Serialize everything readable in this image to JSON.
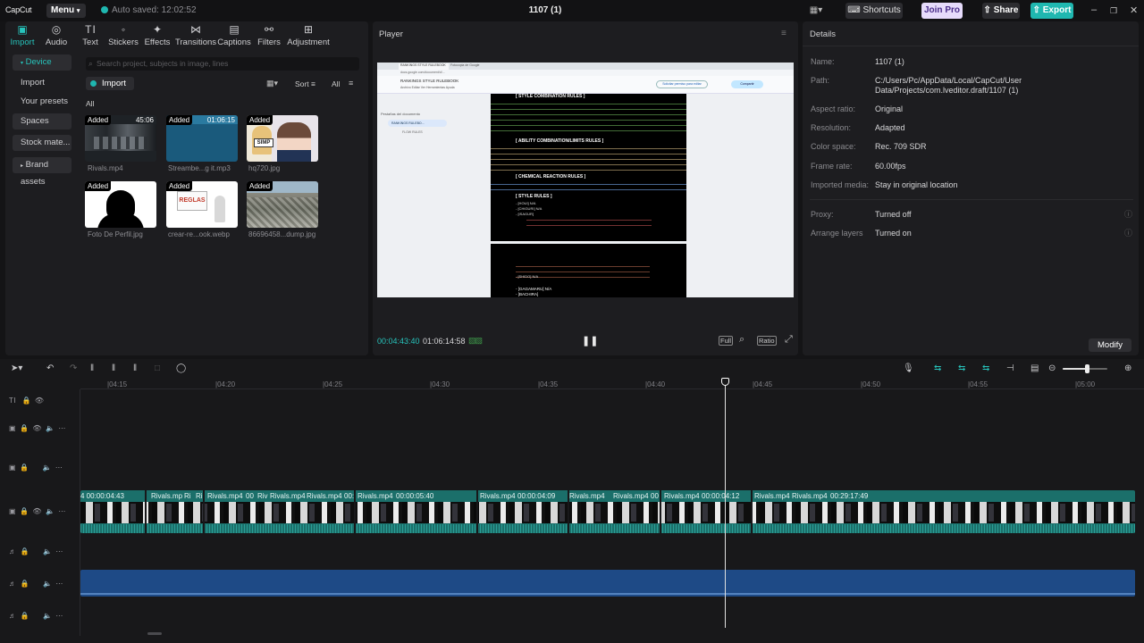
{
  "app": {
    "logo": "CapCut",
    "menu_label": "Menu",
    "autosave": "Auto saved: 12:02:52",
    "project_title": "1107 (1)",
    "shortcuts_label": "Shortcuts",
    "joinpro_label": "Join Pro",
    "share_label": "Share",
    "export_label": "Export",
    "accent_color": "#1fb7b0"
  },
  "toolbar_tabs": [
    {
      "label": "Import",
      "icon": "import-icon"
    },
    {
      "label": "Audio",
      "icon": "audio-icon"
    },
    {
      "label": "Text",
      "icon": "text-icon"
    },
    {
      "label": "Stickers",
      "icon": "stickers-icon"
    },
    {
      "label": "Effects",
      "icon": "effects-icon"
    },
    {
      "label": "Transitions",
      "icon": "transitions-icon"
    },
    {
      "label": "Captions",
      "icon": "captions-icon"
    },
    {
      "label": "Filters",
      "icon": "filters-icon"
    },
    {
      "label": "Adjustment",
      "icon": "adjustment-icon"
    }
  ],
  "media_sidebar": [
    "Device",
    "Import",
    "Your presets",
    "Spaces",
    "Stock mate...",
    "Brand assets"
  ],
  "media": {
    "search_placeholder": "Search project, subjects in image, lines",
    "import_label": "Import",
    "sort_label": "Sort",
    "all_filter": "All",
    "all_heading": "All",
    "items": [
      {
        "name": "Rivals.mp4",
        "badge": "Added",
        "duration": "45:06"
      },
      {
        "name": "Streambe...g it.mp3",
        "badge": "Added",
        "duration": "01:06:15"
      },
      {
        "name": "hq720.jpg",
        "badge": "Added",
        "duration": ""
      },
      {
        "name": "Foto De Perfil.jpg",
        "badge": "Added",
        "duration": ""
      },
      {
        "name": "crear-re...ook.webp",
        "badge": "Added",
        "duration": ""
      },
      {
        "name": "86696458...dump.jpg",
        "badge": "Added",
        "duration": ""
      }
    ],
    "thumb_texts": {
      "simp": "SIMP",
      "reglas": "REGLAS"
    }
  },
  "player": {
    "title": "Player",
    "current_time": "00:04:43:40",
    "total_time": "01:06:14:58",
    "full_label": "Full",
    "ratio_label": "Ratio",
    "doc": {
      "tab1": "RANKINGS STYLE RULEBOOK",
      "tab2": "Fotocopia de Google",
      "url": "docs.google.com/document/d/...",
      "doc_title": "RANKINGS STYLE RULEBOOK",
      "menu": "Archivo  Editar  Ver  Herramientas  Ayuda",
      "request_btn": "Solicitar permiso para editar",
      "share_btn": "Compartir",
      "outline_title": "Pestañas del documento",
      "outline_item": "RANKINGS RULEBO...",
      "outline_sub": "FLOW RULES",
      "page1": [
        "[ STYLE COMBINATION RULES ]",
        "[ ABILITY COMBINATION/LIMITS RULES ]",
        "[ CHEMICAL REACTION RULES ]",
        "[ STYLE RULES ]",
        "- [HOUI] N/A",
        "- [CHIGURI] N/A",
        "- [ISAGUR]"
      ],
      "page2": [
        "- [SHIDO] N/A",
        "- [GAGAMARU] N/A",
        "- [BACHIRA]"
      ]
    }
  },
  "details": {
    "title": "Details",
    "rows": [
      {
        "label": "Name:",
        "value": "1107 (1)"
      },
      {
        "label": "Path:",
        "value": "C:/Users/Pc/AppData/Local/CapCut/User Data/Projects/com.lveditor.draft/1107 (1)"
      },
      {
        "label": "Aspect ratio:",
        "value": "Original"
      },
      {
        "label": "Resolution:",
        "value": "Adapted"
      },
      {
        "label": "Color space:",
        "value": "Rec. 709 SDR"
      },
      {
        "label": "Frame rate:",
        "value": "60.00fps"
      },
      {
        "label": "Imported media:",
        "value": "Stay in original location"
      },
      {
        "label": "Proxy:",
        "value": "Turned off"
      },
      {
        "label": "Arrange layers",
        "value": "Turned on"
      }
    ],
    "modify_label": "Modify"
  },
  "timeline": {
    "ruler": [
      "|04:15",
      "|04:20",
      "|04:25",
      "|04:30",
      "|04:35",
      "|04:40",
      "|04:45",
      "|04:50",
      "|04:55",
      "|05:00"
    ],
    "clip_labels": [
      "4  00:00:04:43",
      "Rivals.mp",
      "Ri",
      "Ri",
      "Rivals.mp4",
      "00",
      "Riv",
      "Rivals.mp4",
      "Rivals.mp4",
      "00:",
      "Rivals.mp4",
      "00:00:05:40",
      "Rivals.mp4",
      "00:00:04:09",
      "Rivals.mp4",
      "Rivals.mp4",
      "00",
      "Rivals.mp4",
      "00:00:04:12",
      "Rivals.mp4",
      "Rivals.mp4",
      "00:29:17:49"
    ]
  }
}
